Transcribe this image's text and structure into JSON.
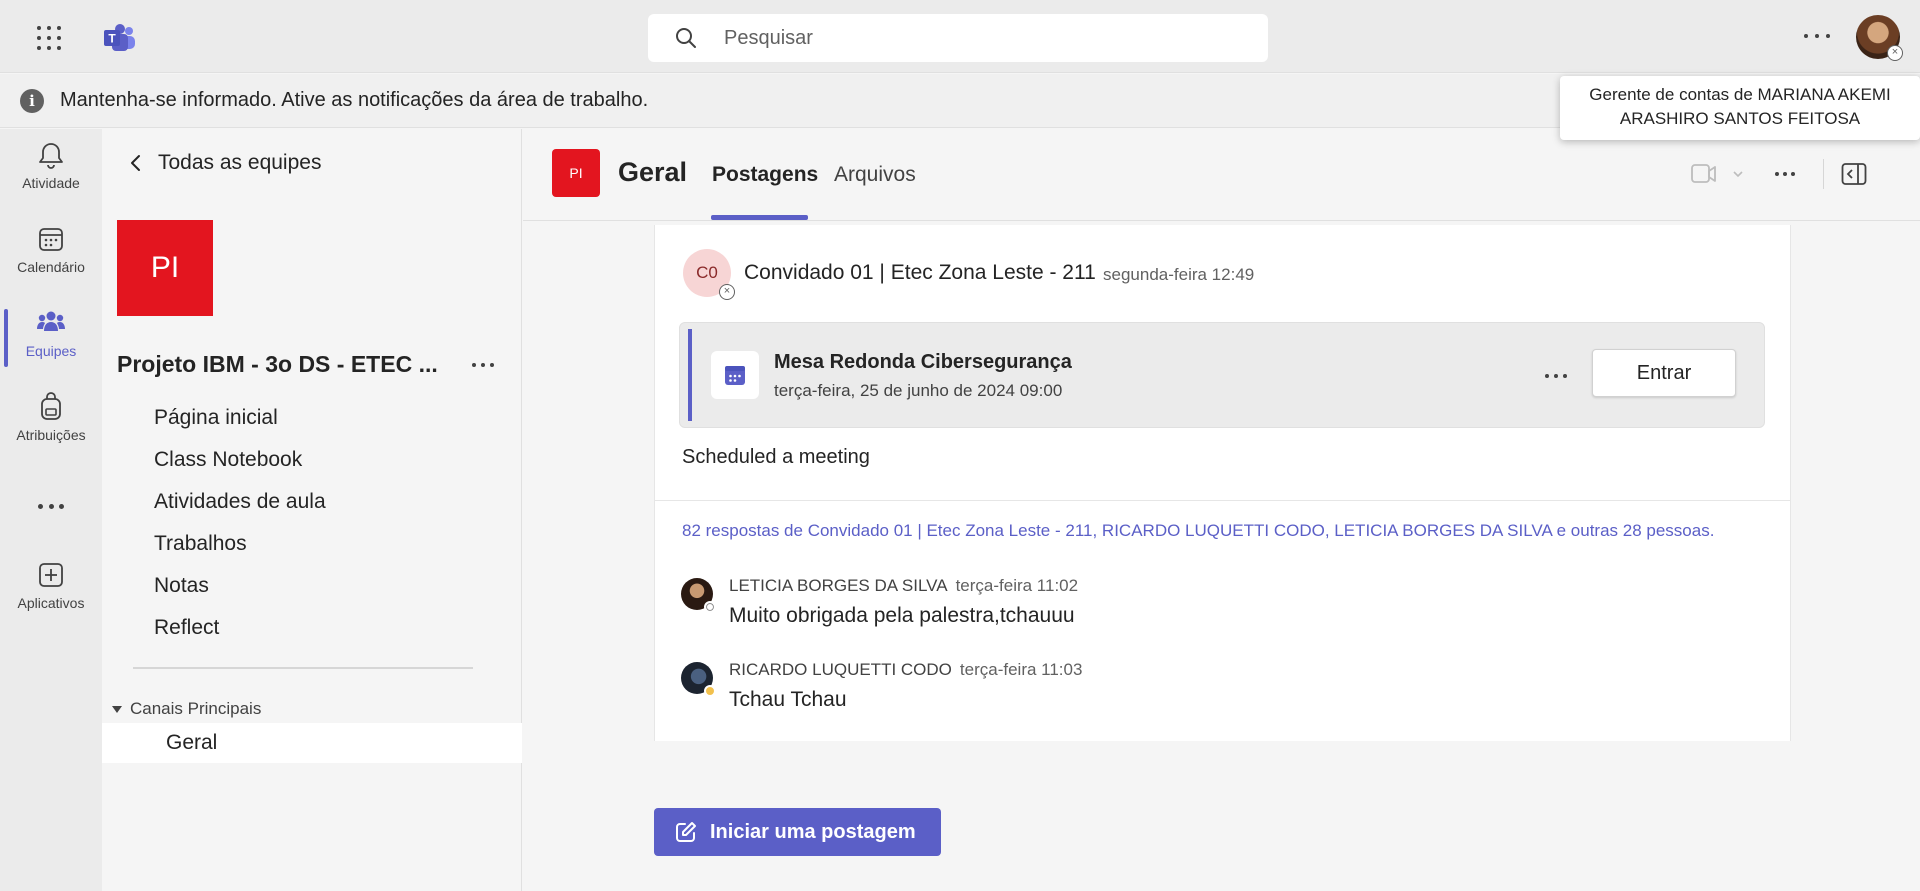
{
  "topbar": {
    "search_placeholder": "Pesquisar"
  },
  "banner": {
    "text": "Mantenha-se informado. Ative as notificações da área de trabalho."
  },
  "tooltip": {
    "text": "Gerente de contas de MARIANA AKEMI ARASHIRO SANTOS FEITOSA"
  },
  "rail": {
    "items": [
      {
        "label": "Atividade",
        "icon": "bell-icon"
      },
      {
        "label": "Calendário",
        "icon": "calendar-icon"
      },
      {
        "label": "Equipes",
        "icon": "teams-icon",
        "active": true
      },
      {
        "label": "Atribuições",
        "icon": "backpack-icon"
      },
      {
        "label": "Aplicativos",
        "icon": "add-apps-icon"
      }
    ]
  },
  "team": {
    "back_label": "Todas as equipes",
    "tile_initials": "PI",
    "name": "Projeto IBM - 3o DS - ETEC ...",
    "nav": [
      "Página inicial",
      "Class Notebook",
      "Atividades de aula",
      "Trabalhos",
      "Notas",
      "Reflect"
    ],
    "section_label": "Canais Principais",
    "channel_label": "Geral"
  },
  "channel_header": {
    "tile_initials": "PI",
    "name": "Geral",
    "tabs": [
      "Postagens",
      "Arquivos"
    ],
    "active_tab": "Postagens"
  },
  "post": {
    "author_initials": "C0",
    "author": "Convidado 01 | Etec Zona Leste - 211",
    "time": "segunda-feira 12:49",
    "meeting": {
      "title": "Mesa Redonda Cibersegurança",
      "date": "terça-feira, 25 de junho de 2024 09:00",
      "join_label": "Entrar"
    },
    "text": "Scheduled a meeting",
    "replies_summary": "82 respostas de Convidado 01 | Etec Zona Leste - 211, RICARDO LUQUETTI CODO, LETICIA BORGES DA SILVA e outras 28 pessoas.",
    "replies": [
      {
        "name": "LETICIA BORGES DA SILVA",
        "time": "terça-feira 11:02",
        "message": "Muito obrigada pela palestra,tchauuu",
        "status_color": "#ffffff"
      },
      {
        "name": "RICARDO LUQUETTI CODO",
        "time": "terça-feira 11:03",
        "message": "Tchau Tchau",
        "status_color": "#f2c14e"
      }
    ]
  },
  "new_post_label": "Iniciar uma postagem",
  "colors": {
    "accent": "#5b5fc7",
    "team_tile": "#e3151f"
  }
}
